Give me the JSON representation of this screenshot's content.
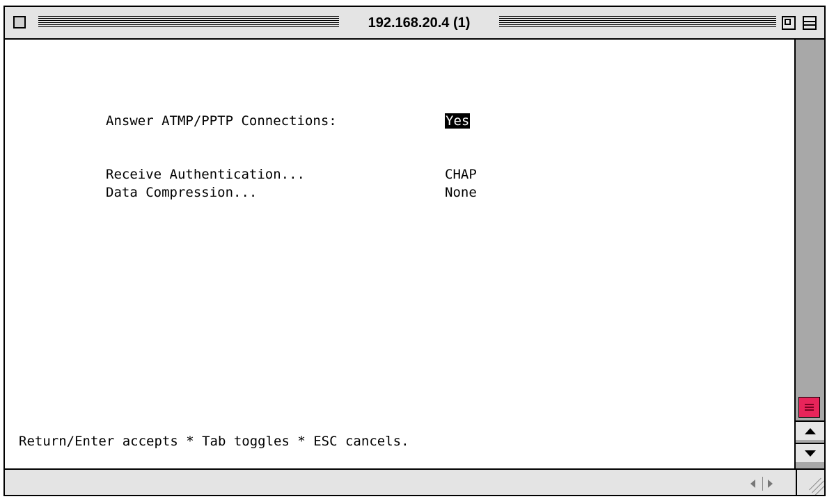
{
  "window": {
    "title": "192.168.20.4 (1)"
  },
  "terminal": {
    "fields": [
      {
        "label": "Answer ATMP/PPTP Connections:",
        "value": "Yes",
        "selected": true
      },
      {
        "label": "Receive Authentication...",
        "value": "CHAP",
        "selected": false
      },
      {
        "label": "Data Compression...",
        "value": "None",
        "selected": false
      }
    ],
    "status_line": "Return/Enter accepts * Tab toggles * ESC cancels."
  },
  "colors": {
    "scroll_thumb": "#e8245a",
    "scroll_track": "#a8a8a8",
    "selection_bg": "#000000",
    "selection_fg": "#ffffff"
  },
  "icons": {
    "close": "close-box-icon",
    "zoom": "zoom-box-icon",
    "collapse": "collapse-box-icon",
    "scroll_up": "arrow-up-icon",
    "scroll_down": "arrow-down-icon",
    "scroll_left": "arrow-left-icon",
    "scroll_right": "arrow-right-icon",
    "resize": "resize-grip-icon"
  }
}
